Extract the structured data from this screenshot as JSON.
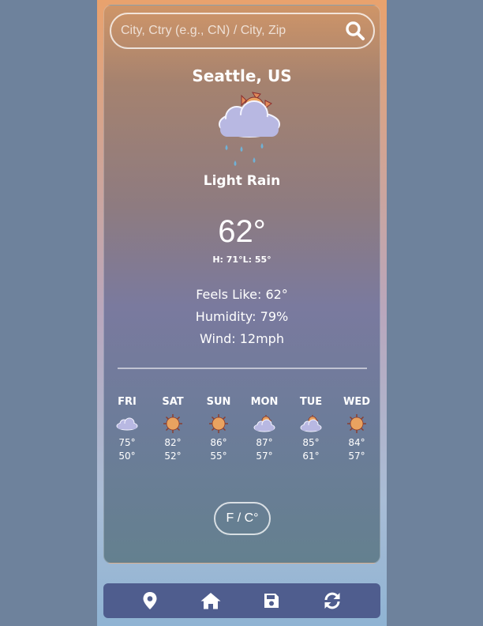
{
  "search": {
    "placeholder": "City, Ctry (e.g., CN) / City, Zip",
    "value": ""
  },
  "current": {
    "city": "Seattle, US",
    "condition": "Light Rain",
    "icon": "cloud-sun-rain-icon",
    "temp": "62°",
    "hilo": "H: 71°L: 55°",
    "feels_like": "Feels Like: 62°",
    "humidity": "Humidity: 79%",
    "wind": "Wind: 12mph"
  },
  "forecast": [
    {
      "day": "FRI",
      "icon": "cloud-icon",
      "hi": "75°",
      "lo": "50°"
    },
    {
      "day": "SAT",
      "icon": "sun-icon",
      "hi": "82°",
      "lo": "52°"
    },
    {
      "day": "SUN",
      "icon": "sun-icon",
      "hi": "86°",
      "lo": "55°"
    },
    {
      "day": "MON",
      "icon": "partly-cloudy-icon",
      "hi": "87°",
      "lo": "57°"
    },
    {
      "day": "TUE",
      "icon": "partly-cloudy-icon",
      "hi": "85°",
      "lo": "61°"
    },
    {
      "day": "WED",
      "icon": "sun-icon",
      "hi": "84°",
      "lo": "57°"
    }
  ],
  "unit_toggle_label": "F / C°",
  "nav": [
    "location-pin-icon",
    "home-icon",
    "save-icon",
    "refresh-icon"
  ],
  "colors": {
    "nav_bg": "#4f5d8e",
    "sun": "#e9a260",
    "cloud": "#b8b8e2",
    "rain": "#6fb1d6"
  }
}
